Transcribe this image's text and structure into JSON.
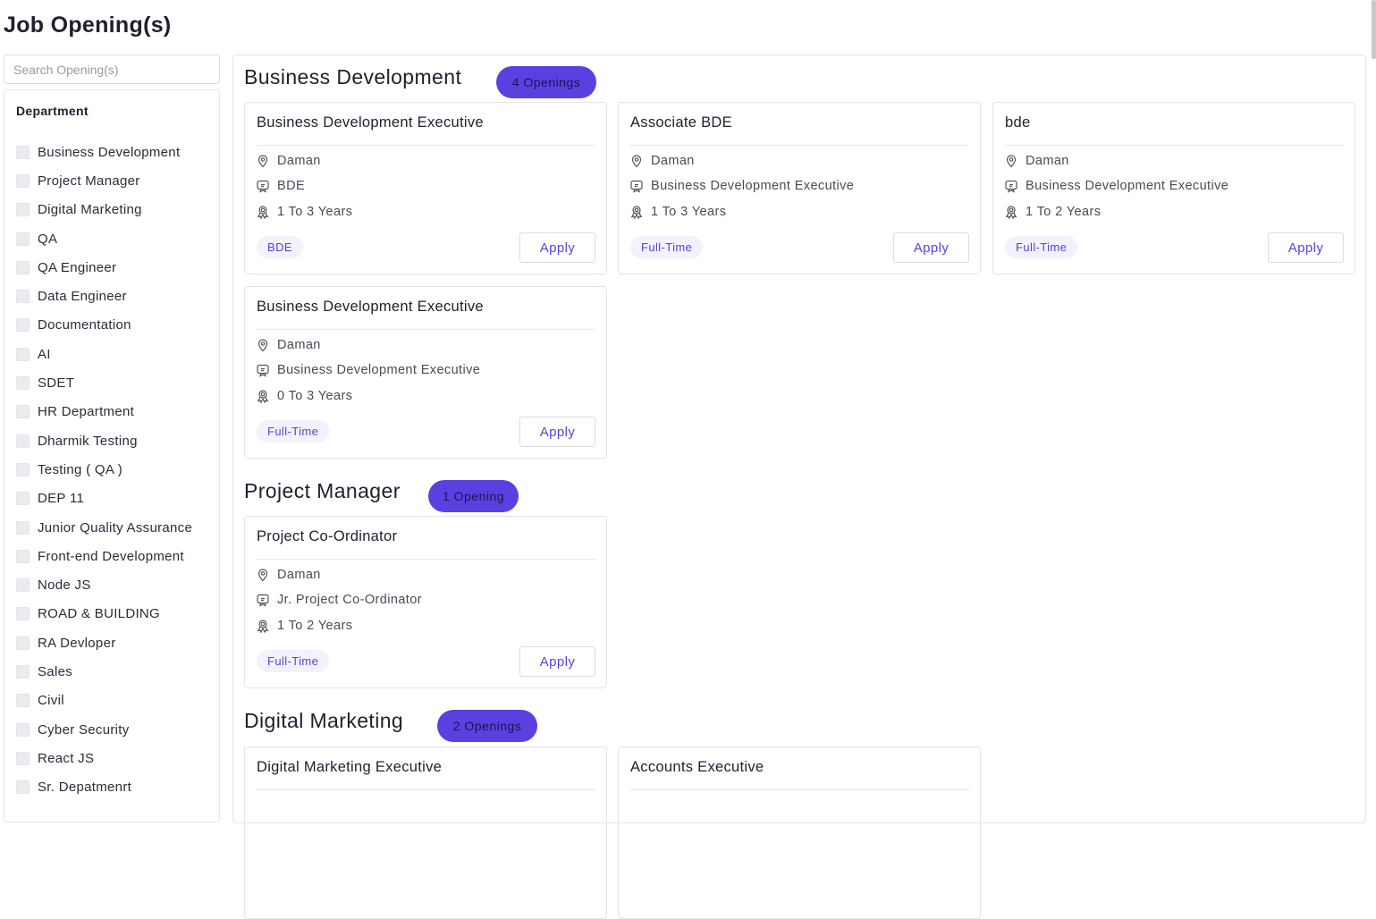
{
  "page": {
    "title": "Job Opening(s)"
  },
  "search": {
    "placeholder": "Search Opening(s)"
  },
  "sidebar": {
    "heading": "Department",
    "items": [
      "Business Development",
      "Project Manager",
      "Digital Marketing",
      "QA",
      "QA Engineer",
      "Data Engineer",
      "Documentation",
      "AI",
      "SDET",
      "HR Department",
      "Dharmik Testing",
      "Testing ( QA )",
      "DEP 11",
      "Junior Quality Assurance",
      "Front-end Development",
      "Node JS",
      "ROAD & BUILDING",
      "RA Devloper",
      "Sales",
      "Civil",
      "Cyber Security",
      "React JS",
      "Sr. Depatmenrt"
    ]
  },
  "apply_label": "Apply",
  "sections": [
    {
      "title": "Business Development",
      "count": "4 Openings",
      "jobs": [
        {
          "title": "Business Development Executive",
          "location": "Daman",
          "role": "BDE",
          "experience": "1 To 3 Years",
          "tag": "BDE"
        },
        {
          "title": "Associate BDE",
          "location": "Daman",
          "role": "Business Development Executive",
          "experience": "1 To 3 Years",
          "tag": "Full-Time"
        },
        {
          "title": "bde",
          "location": "Daman",
          "role": "Business Development Executive",
          "experience": "1 To 2 Years",
          "tag": "Full-Time"
        },
        {
          "title": "Business Development Executive",
          "location": "Daman",
          "role": "Business Development Executive",
          "experience": "0 To 3 Years",
          "tag": "Full-Time"
        }
      ]
    },
    {
      "title": "Project Manager",
      "count": "1 Opening",
      "jobs": [
        {
          "title": "Project Co-Ordinator",
          "location": "Daman",
          "role": "Jr. Project Co-Ordinator",
          "experience": "1 To 2 Years",
          "tag": "Full-Time"
        }
      ]
    },
    {
      "title": "Digital Marketing",
      "count": "2 Openings",
      "jobs": [
        {
          "title": "Digital Marketing Executive"
        },
        {
          "title": "Accounts Executive"
        }
      ]
    }
  ],
  "colors": {
    "accent": "#5b3fe0",
    "tag_bg": "#f3f1fc",
    "border": "#e3e3ea"
  }
}
